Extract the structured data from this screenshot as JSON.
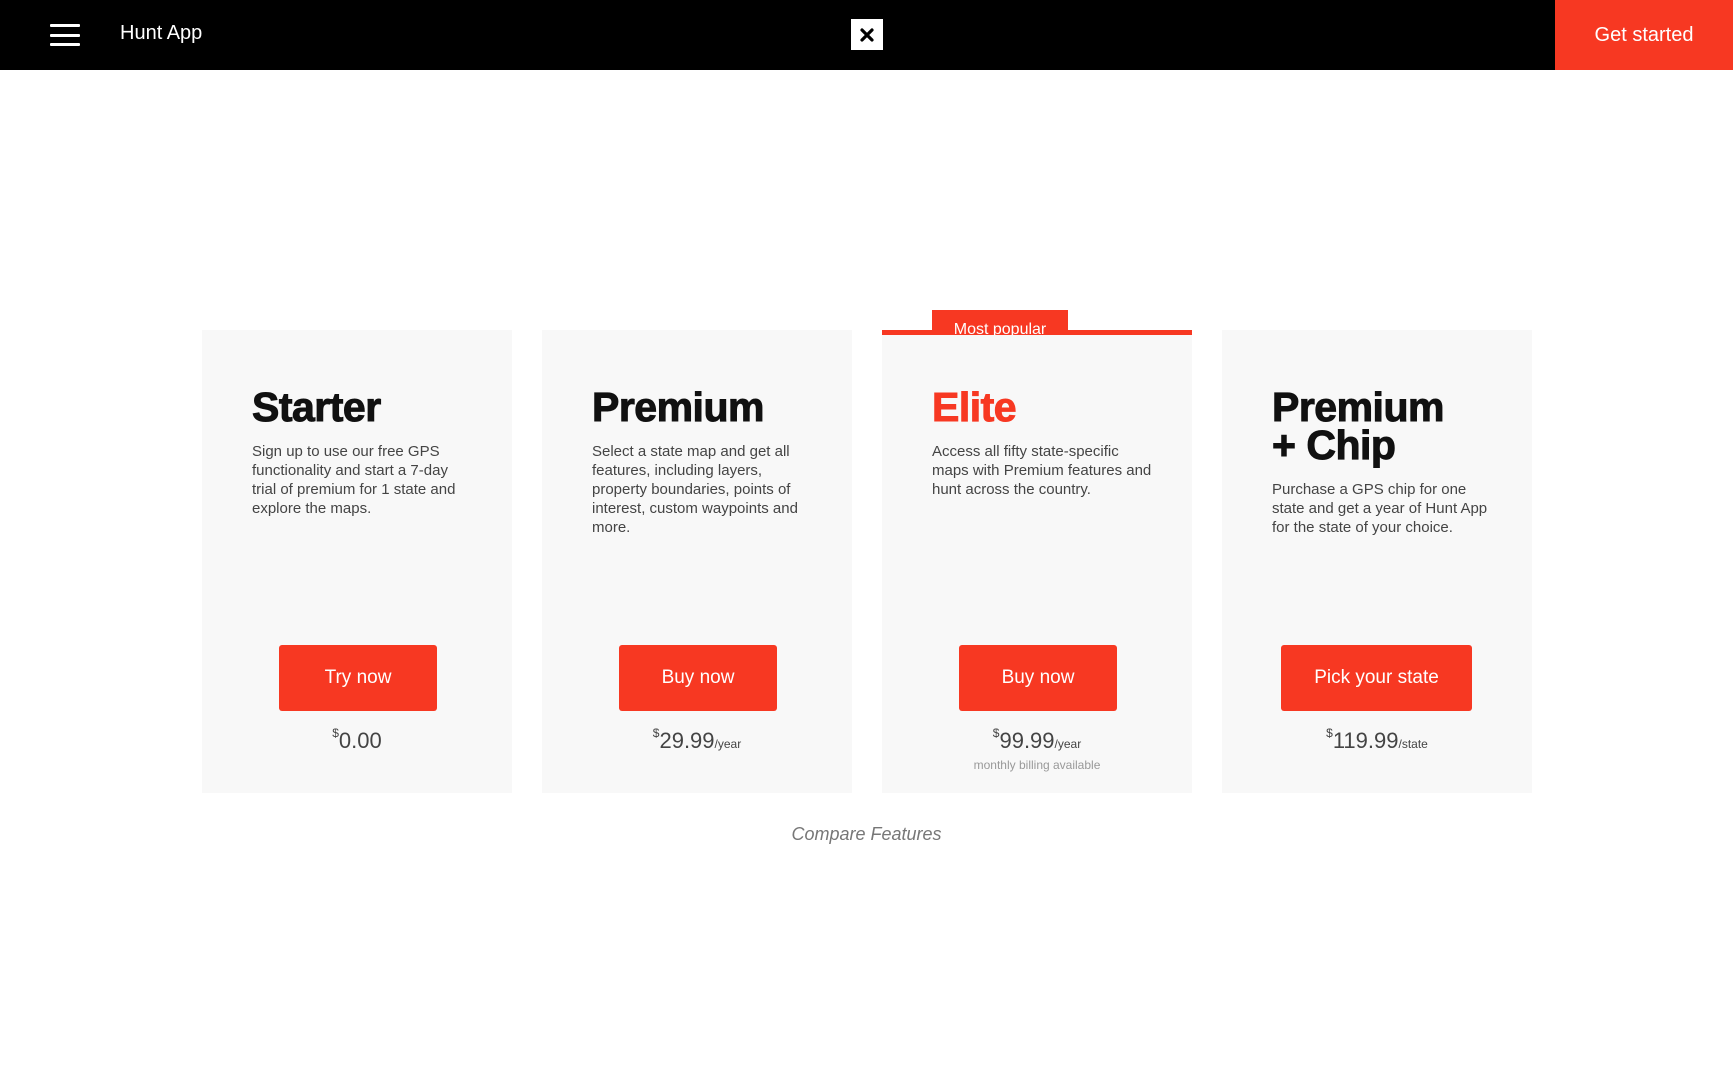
{
  "header": {
    "app_title": "Hunt App",
    "get_started_label": "Get started",
    "menu_icon": "hamburger-icon",
    "logo_icon": "close-x-logo-icon"
  },
  "colors": {
    "accent": "#f73822",
    "header_bg": "#000000",
    "card_bg": "#f8f8f8"
  },
  "badge": {
    "label": "Most popular"
  },
  "plans": [
    {
      "name": "Starter",
      "description": "Sign up to use our free GPS functionality and start a 7-day trial of premium for 1 state and explore the maps.",
      "cta": "Try now",
      "currency": "$",
      "price": "0.00",
      "period": ""
    },
    {
      "name": "Premium",
      "description": "Select a state map and get all features, including layers, property boundaries, points of interest, custom waypoints and more.",
      "cta": "Buy now",
      "currency": "$",
      "price": "29.99",
      "period": "/year"
    },
    {
      "name": "Elite",
      "description": "Access all fifty state-specific maps with Premium features and hunt across the country.",
      "cta": "Buy now",
      "currency": "$",
      "price": "99.99",
      "period": "/year",
      "note": "monthly billing available"
    },
    {
      "name": "Premium\n+ Chip",
      "description": "Purchase a GPS chip for one state and get a year of Hunt App for the state of your choice.",
      "cta": "Pick your state",
      "currency": "$",
      "price": "119.99",
      "period": "/state"
    }
  ],
  "compare_label": "Compare Features"
}
